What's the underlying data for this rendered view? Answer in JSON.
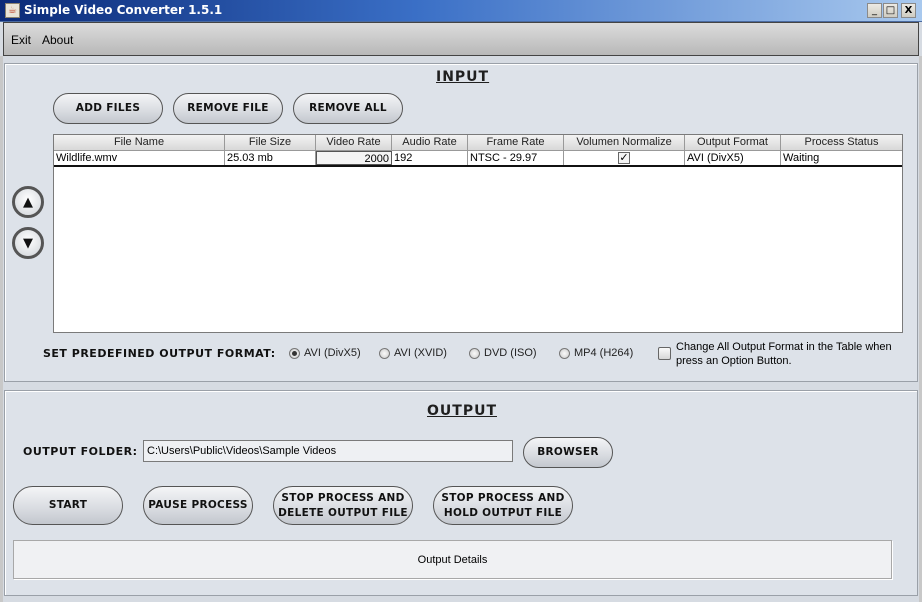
{
  "window": {
    "title": "Simple Video Converter 1.5.1",
    "controls": {
      "minimize": "_",
      "maximize": "□",
      "close": "X"
    }
  },
  "menu": {
    "items": [
      {
        "label": "Exit"
      },
      {
        "label": "About"
      }
    ]
  },
  "input": {
    "title": "INPUT",
    "buttons": {
      "add_files": "ADD FILES",
      "remove_file": "REMOVE FILE",
      "remove_all": "REMOVE ALL"
    },
    "move_up_icon": "▲",
    "move_down_icon": "▼",
    "table": {
      "columns": [
        "File Name",
        "File Size",
        "Video Rate",
        "Audio Rate",
        "Frame Rate",
        "Volumen Normalize",
        "Output Format",
        "Process Status"
      ],
      "rows": [
        {
          "file_name": "Wildlife.wmv",
          "file_size": "25.03 mb",
          "video_rate": "2000",
          "audio_rate": "192",
          "frame_rate": "NTSC - 29.97",
          "volume_normalize": "✓",
          "output_format": "AVI (DivX5)",
          "status": "Waiting"
        }
      ]
    },
    "predefined_label": "SET PREDEFINED OUTPUT FORMAT:",
    "formats": [
      {
        "label": "AVI (DivX5)",
        "selected": true
      },
      {
        "label": "AVI (XVID)",
        "selected": false
      },
      {
        "label": "DVD (ISO)",
        "selected": false
      },
      {
        "label": "MP4 (H264)",
        "selected": false
      }
    ],
    "change_all_label_line1": "Change All Output Format in the Table when",
    "change_all_label_line2": "press an Option Button.",
    "change_all_checked": false
  },
  "output": {
    "title": "OUTPUT",
    "folder_label": "OUTPUT FOLDER:",
    "folder_value": "C:\\Users\\Public\\Videos\\Sample Videos",
    "browser_button": "BROWSER",
    "buttons": {
      "start": "START",
      "pause": "PAUSE PROCESS",
      "stop_delete_l1": "STOP PROCESS AND",
      "stop_delete_l2": "DELETE OUTPUT FILE",
      "stop_hold_l1": "STOP PROCESS AND",
      "stop_hold_l2": "HOLD OUTPUT FILE"
    },
    "details_label": "Output Details"
  }
}
